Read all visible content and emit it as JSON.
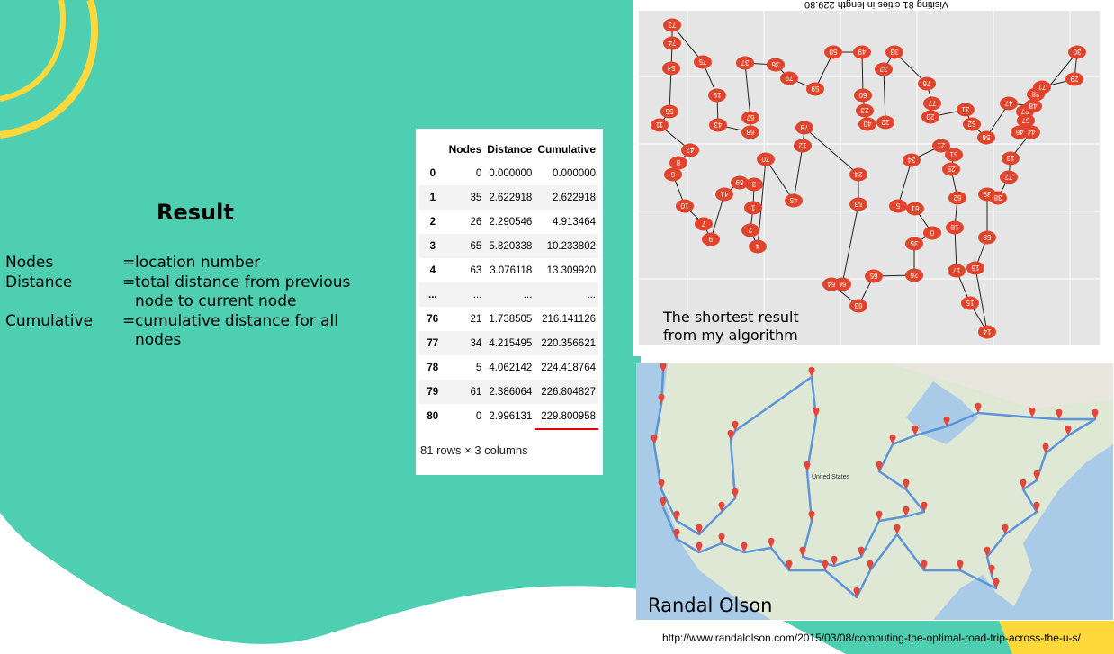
{
  "slide": {
    "title": "Result",
    "definitions": [
      {
        "term": "Nodes",
        "desc": "location number"
      },
      {
        "term": "Distance",
        "desc": "total distance from  previous node to current node"
      },
      {
        "term": "Cumulative",
        "desc": "cumulative distance for all nodes"
      }
    ]
  },
  "table": {
    "columns": [
      "",
      "Nodes",
      "Distance",
      "Cumulative"
    ],
    "rows": [
      [
        "0",
        "0",
        "0.000000",
        "0.000000"
      ],
      [
        "1",
        "35",
        "2.622918",
        "2.622918"
      ],
      [
        "2",
        "26",
        "2.290546",
        "4.913464"
      ],
      [
        "3",
        "65",
        "5.320338",
        "10.233802"
      ],
      [
        "4",
        "63",
        "3.076118",
        "13.309920"
      ],
      [
        "...",
        "...",
        "...",
        "..."
      ],
      [
        "76",
        "21",
        "1.738505",
        "216.141126"
      ],
      [
        "77",
        "34",
        "4.215495",
        "220.356621"
      ],
      [
        "78",
        "5",
        "4.062142",
        "224.418764"
      ],
      [
        "79",
        "61",
        "2.386064",
        "226.804827"
      ],
      [
        "80",
        "0",
        "2.996131",
        "229.800958"
      ]
    ],
    "footer": "81 rows × 3 columns"
  },
  "plot": {
    "title": "Visiting 81 cities in length 229.80",
    "caption_line1": "The shortest result",
    "caption_line2": "from my algorithm"
  },
  "map": {
    "credit": "Randal Olson",
    "country_label": "United States",
    "url": "http://www.randalolson.com/2015/03/08/computing-the-optimal-road-trip-across-the-u-s/"
  },
  "colors": {
    "teal": "#4ecfb2",
    "yellow": "#ffd93b",
    "node_red": "#e0442c",
    "route_blue": "#5c95d8",
    "pin_red": "#e6453a"
  }
}
